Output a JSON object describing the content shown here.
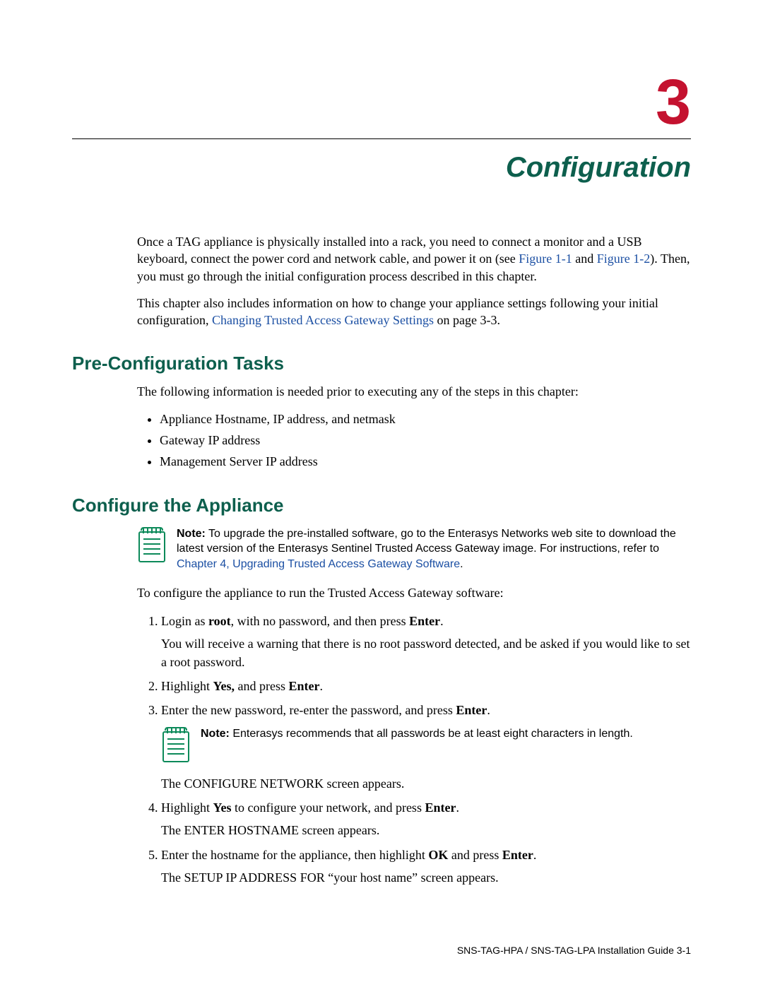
{
  "chapter": {
    "number": "3",
    "title": "Configuration"
  },
  "intro": {
    "p1_a": "Once a TAG appliance is physically installed into a rack, you need to connect a monitor and a USB keyboard, connect the power cord and network cable, and power it on (see ",
    "fig11": "Figure 1-1",
    "p1_b": " and ",
    "fig12": "Figure 1-2",
    "p1_c": "). Then, you must go through the initial configuration process described in this chapter.",
    "p2_a": "This chapter also includes information on how to change your appliance settings following your initial configuration, ",
    "p2_link": "Changing Trusted Access Gateway Settings",
    "p2_b": " on page 3-3."
  },
  "preconfig": {
    "heading": "Pre-Configuration Tasks",
    "lead": "The following information is needed prior to executing any of the steps in this chapter:",
    "items": [
      "Appliance Hostname, IP address, and netmask",
      "Gateway IP address",
      "Management Server IP address"
    ]
  },
  "configure": {
    "heading": "Configure the Appliance",
    "note1_label": "Note:",
    "note1_a": " To upgrade the pre-installed software, go to the Enterasys Networks web site to download the latest version of the Enterasys Sentinel Trusted Access Gateway image. For instructions, refer to ",
    "note1_link": "Chapter 4, Upgrading Trusted Access Gateway Software",
    "note1_b": ".",
    "lead": "To configure the appliance to run the Trusted Access Gateway software:",
    "steps": {
      "s1a": "Login as ",
      "s1_root": "root",
      "s1b": ", with no password, and then press ",
      "s1_enter": "Enter",
      "s1c": ".",
      "s1_followup": "You will receive a warning that there is no root password detected, and be asked if you would like to set a root password.",
      "s2a": "Highlight ",
      "s2_yes": "Yes,",
      "s2b": " and press ",
      "s2_enter": "Enter",
      "s2c": ".",
      "s3a": "Enter the new password, re-enter the password, and press ",
      "s3_enter": "Enter",
      "s3b": ".",
      "note2_label": "Note:",
      "note2_text": " Enterasys recommends that all passwords be at least eight characters in length.",
      "s3_followup": "The CONFIGURE NETWORK screen appears.",
      "s4a": "Highlight ",
      "s4_yes": "Yes",
      "s4b": " to configure your network, and press ",
      "s4_enter": "Enter",
      "s4c": ".",
      "s4_followup": "The ENTER HOSTNAME screen appears.",
      "s5a": "Enter the hostname for the appliance, then highlight ",
      "s5_ok": "OK",
      "s5b": " and press ",
      "s5_enter": "Enter",
      "s5c": ".",
      "s5_followup": "The SETUP IP ADDRESS FOR “your host name” screen appears."
    }
  },
  "footer": {
    "text": "SNS-TAG-HPA / SNS-TAG-LPA Installation Guide   3-1"
  }
}
